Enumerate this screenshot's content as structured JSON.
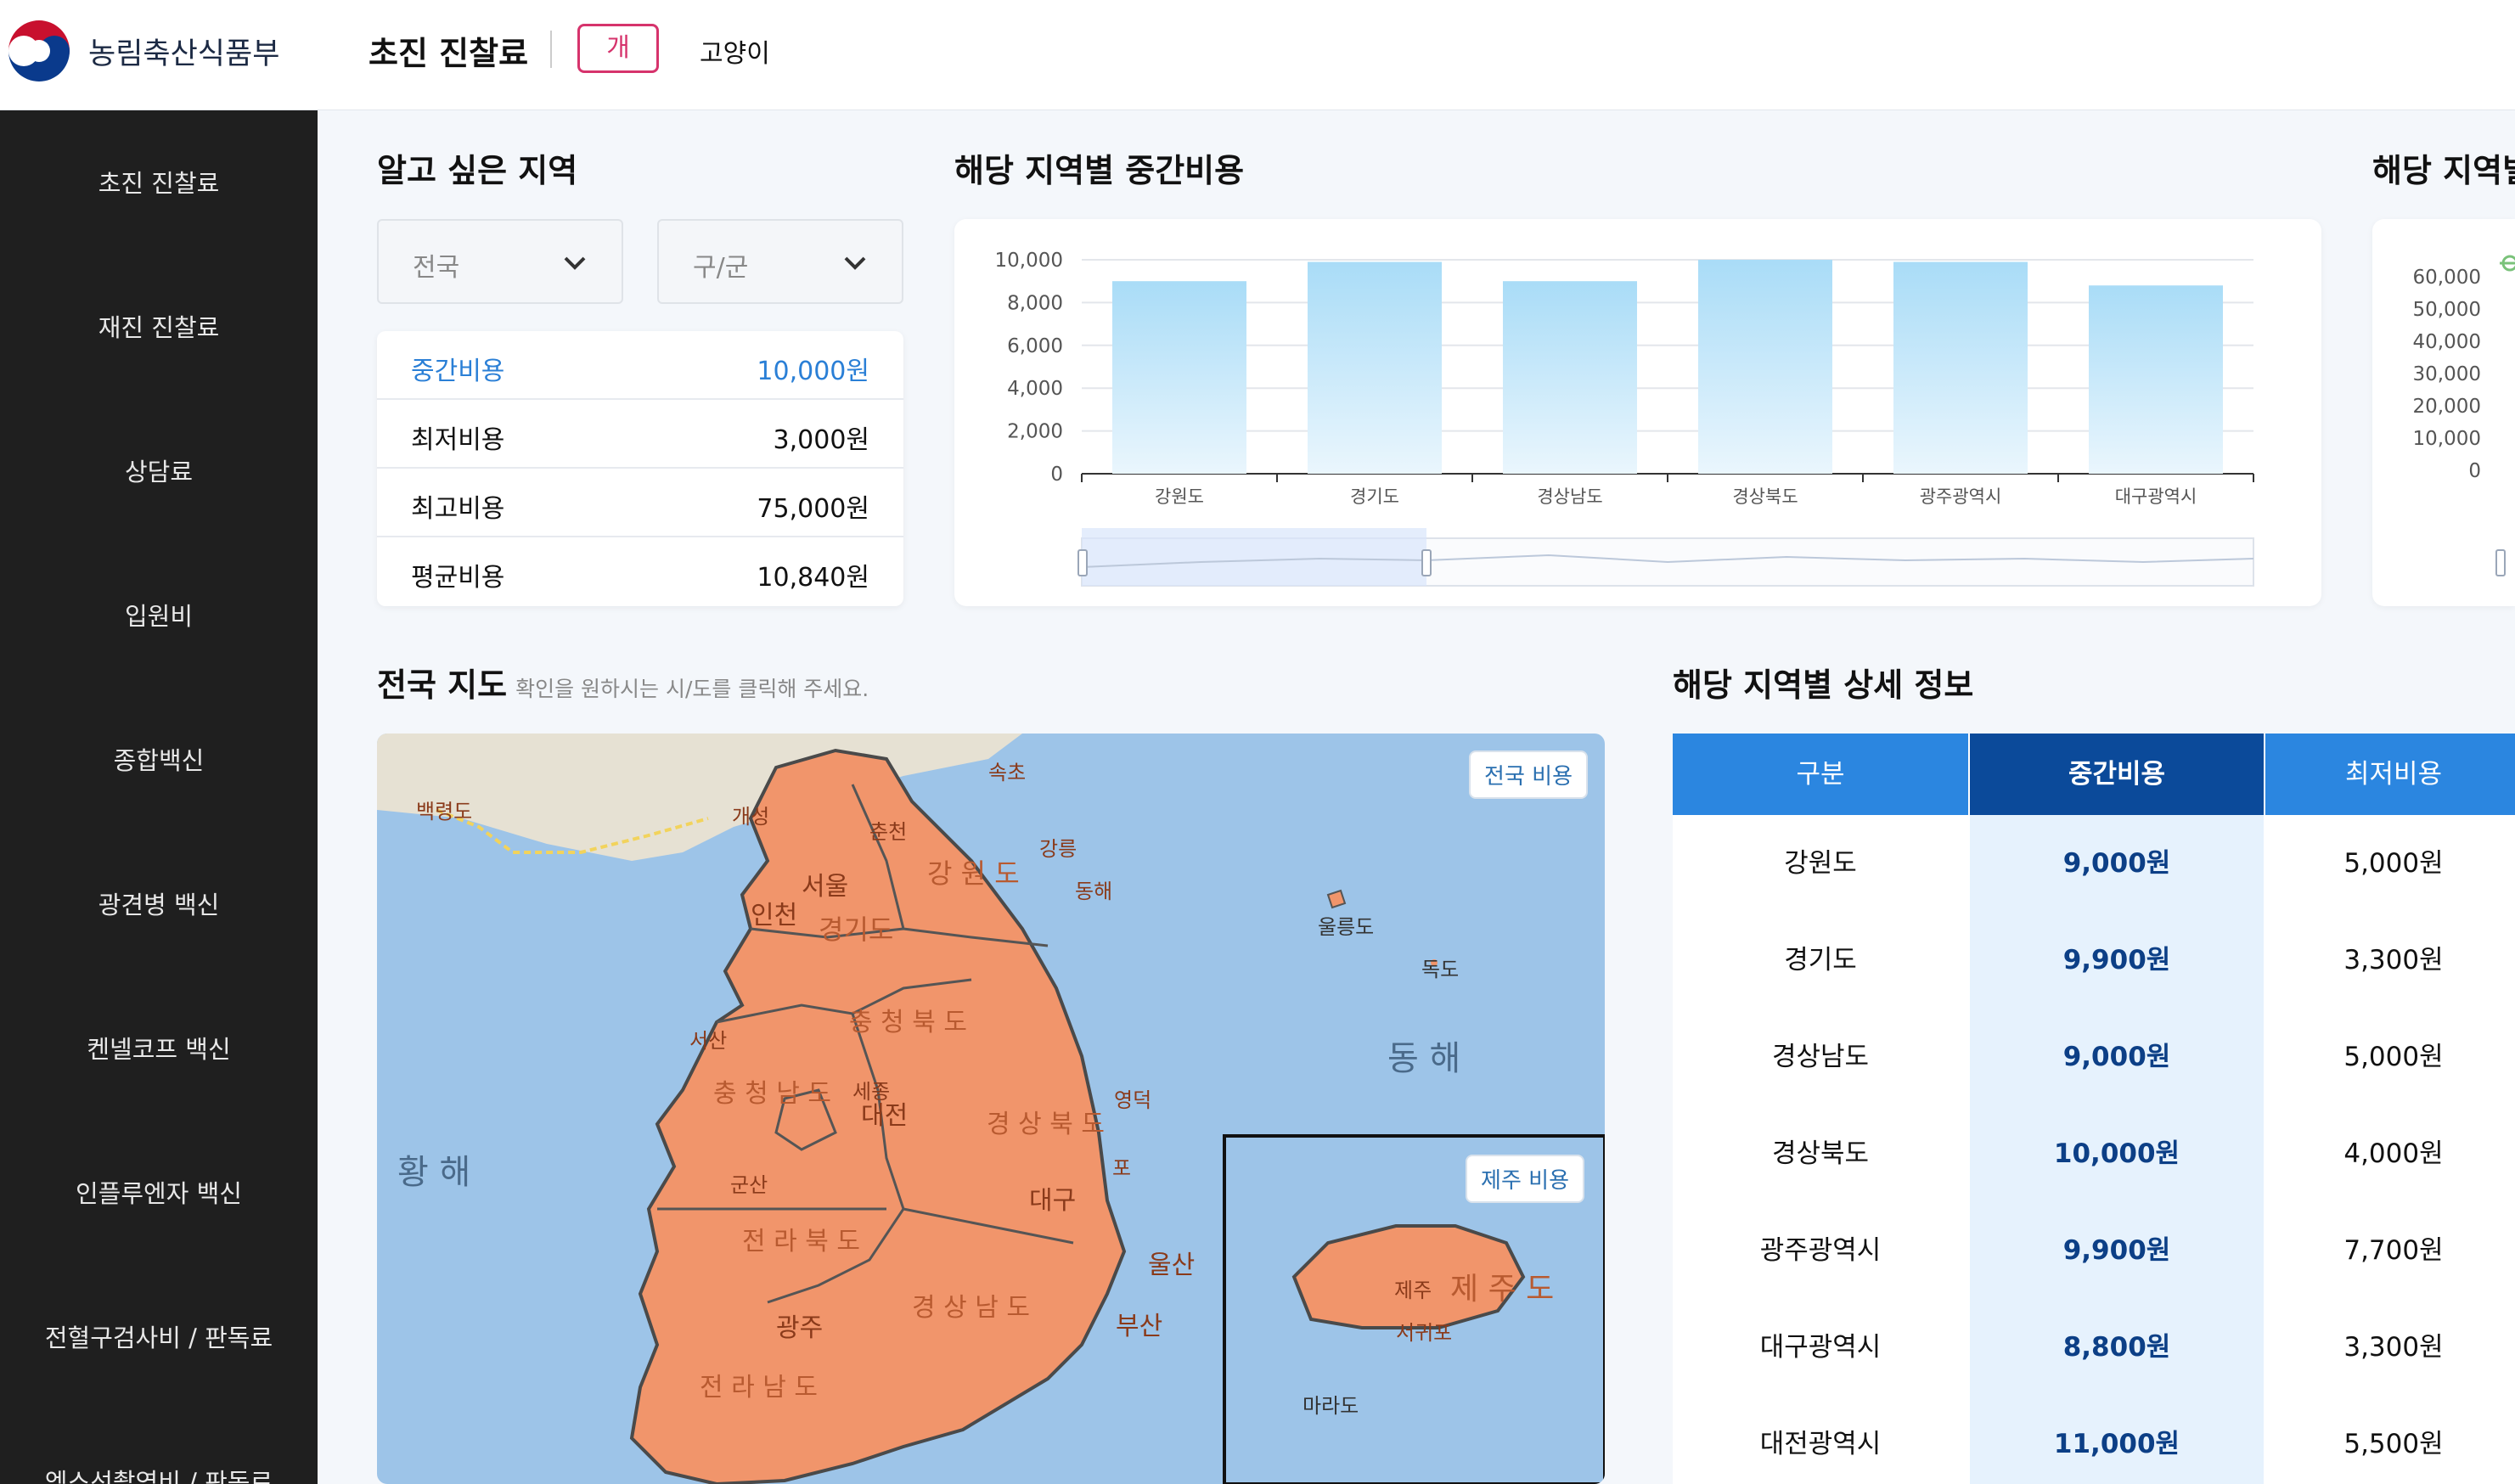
{
  "header": {
    "org_name": "농림축산식품부",
    "page_title": "초진 진찰료",
    "pet_dog": "개",
    "pet_cat": "고양이"
  },
  "sidebar": {
    "items": [
      "초진 진찰료",
      "재진 진찰료",
      "상담료",
      "입원비",
      "종합백신",
      "광견병 백신",
      "켄넬코프 백신",
      "인플루엔자 백신",
      "전혈구검사비 / 판독료",
      "엑스선촬영비 / 판독료"
    ]
  },
  "region": {
    "title": "알고 싶은 지역",
    "province": "전국",
    "district": "구/군"
  },
  "stats": [
    {
      "label": "중간비용",
      "value": "10,000원"
    },
    {
      "label": "최저비용",
      "value": "3,000원"
    },
    {
      "label": "최고비용",
      "value": "75,000원"
    },
    {
      "label": "평균비용",
      "value": "10,840원"
    }
  ],
  "mid_chart_title": "해당 지역별 중간비용",
  "right_chart_title": "해당 지역별",
  "chart_data": [
    {
      "type": "bar",
      "title": "해당 지역별 중간비용",
      "categories": [
        "강원도",
        "경기도",
        "경상남도",
        "경상북도",
        "광주광역시",
        "대구광역시"
      ],
      "values": [
        9000,
        9900,
        9000,
        10000,
        9900,
        8800
      ],
      "yticks": [
        "10,000",
        "8,000",
        "6,000",
        "4,000",
        "2,000",
        "0"
      ],
      "ylim": [
        0,
        10000
      ],
      "grid": true
    },
    {
      "type": "line",
      "title": "해당 지역별",
      "yticks": [
        "60,000",
        "50,000",
        "40,000",
        "30,000",
        "20,000",
        "10,000",
        "0"
      ],
      "ylim": [
        0,
        60000
      ]
    }
  ],
  "map": {
    "title": "전국 지도",
    "subtitle": "확인을 원하시는 시/도를 클릭해 주세요.",
    "national_btn": "전국 비용",
    "jeju_btn": "제주 비용",
    "labels": {
      "baengnyeong": "백령도",
      "gaeseong": "개성",
      "chuncheon": "춘천",
      "sokcho": "속초",
      "gangneung": "강릉",
      "donghae_city": "동해",
      "gangwon": "강 원 도",
      "seoul": "서울",
      "incheon": "인천",
      "gyeonggi": "경기도",
      "ulleung": "울릉도",
      "dokdo": "독도",
      "east_sea": "동 해",
      "yellow_sea": "황 해",
      "chungbuk": "충 청 북 도",
      "seosan": "서산",
      "chungnam": "충 청 남 도",
      "sejong": "세종",
      "daejeon": "대전",
      "gyeongbuk": "경 상 북 도",
      "yeongdeok": "영덕",
      "pohang": "포",
      "gunsan": "군산",
      "daegu": "대구",
      "jeonbuk": "전 라 북 도",
      "ulsan": "울산",
      "gyeongnam": "경 상 남 도",
      "busan": "부산",
      "gwangju": "광주",
      "jeonnam": "전 라 남 도",
      "jeju_city": "제주",
      "jeju_do": "제 주 도",
      "seogwipo": "서귀포",
      "marado": "마라도"
    }
  },
  "detail": {
    "title": "해당 지역별 상세 정보",
    "headers": [
      "구분",
      "중간비용",
      "최저비용"
    ],
    "rows": [
      {
        "region": "강원도",
        "mid": "9,000원",
        "low": "5,000원"
      },
      {
        "region": "경기도",
        "mid": "9,900원",
        "low": "3,300원"
      },
      {
        "region": "경상남도",
        "mid": "9,000원",
        "low": "5,000원"
      },
      {
        "region": "경상북도",
        "mid": "10,000원",
        "low": "4,000원"
      },
      {
        "region": "광주광역시",
        "mid": "9,900원",
        "low": "7,700원"
      },
      {
        "region": "대구광역시",
        "mid": "8,800원",
        "low": "3,300원"
      },
      {
        "region": "대전광역시",
        "mid": "11,000원",
        "low": "5,500원"
      }
    ]
  }
}
